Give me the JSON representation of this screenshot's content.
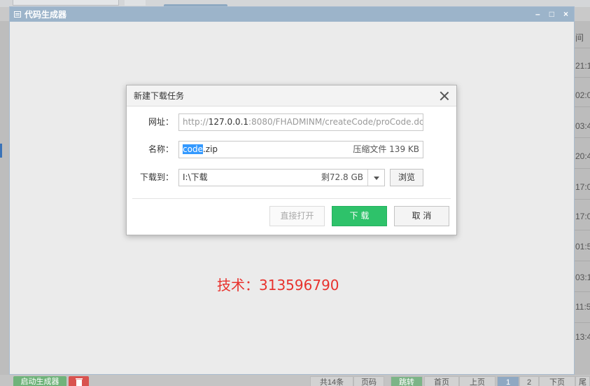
{
  "background": {
    "right_column": {
      "header": "间",
      "times": [
        "21:1",
        "02:0",
        "03:4",
        "20:4",
        "17:0",
        "17:0",
        "01:5",
        "03:1",
        "11:5",
        "13:4"
      ]
    },
    "bottom_bar": {
      "start_button": "启动生成器",
      "delete_icon": "trash-icon",
      "total": "共14条",
      "page_size": "页码",
      "jump_button": "跳转",
      "first_page": "首页",
      "prev_page": "上页",
      "page_1": "1",
      "page_2": "2",
      "next_page": "下页",
      "last_page": "尾"
    }
  },
  "window": {
    "title": "代码生成器",
    "controls": {
      "minimize": "–",
      "maximize": "□",
      "close": "×"
    }
  },
  "dialog": {
    "title": "新建下载任务",
    "url_label": "网址：",
    "url_prefix": "http://",
    "url_host": "127.0.0.1",
    "url_rest": ":8080/FHADMINM/createCode/proCode.dc",
    "name_label": "名称：",
    "name_selected": "code",
    "name_rest": ".zip",
    "file_info": "压缩文件 139 KB",
    "save_label": "下载到：",
    "save_path": "I:\\下载",
    "free_space": "剩72.8 GB",
    "browse_button": "浏览",
    "open_button": "直接打开",
    "download_button": "下 载",
    "cancel_button": "取 消"
  },
  "watermark": "技术：313596790",
  "colors": {
    "window_title_bar": "#9cb4ca",
    "download_green": "#2ec26a",
    "watermark_red": "#e8322d",
    "selection_blue": "#3399ff"
  }
}
